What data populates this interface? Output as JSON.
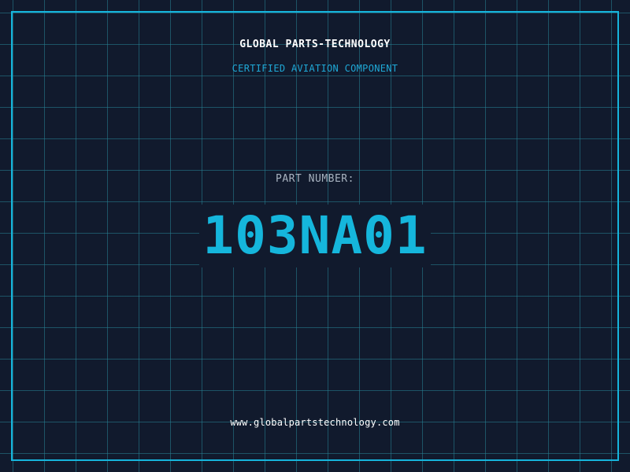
{
  "header": {
    "company": "GLOBAL PARTS-TECHNOLOGY",
    "subtitle": "CERTIFIED AVIATION COMPONENT"
  },
  "part": {
    "label": "PART NUMBER:",
    "number": "103NA01"
  },
  "footer": {
    "url": "www.globalpartstechnology.com"
  },
  "colors": {
    "background": "#111a2d",
    "grid": "#268296",
    "frame": "#16b4dc",
    "accent": "#15b6dc",
    "subtitle": "#1fa8d6",
    "label": "#a8b3c0",
    "text": "#ffffff"
  }
}
